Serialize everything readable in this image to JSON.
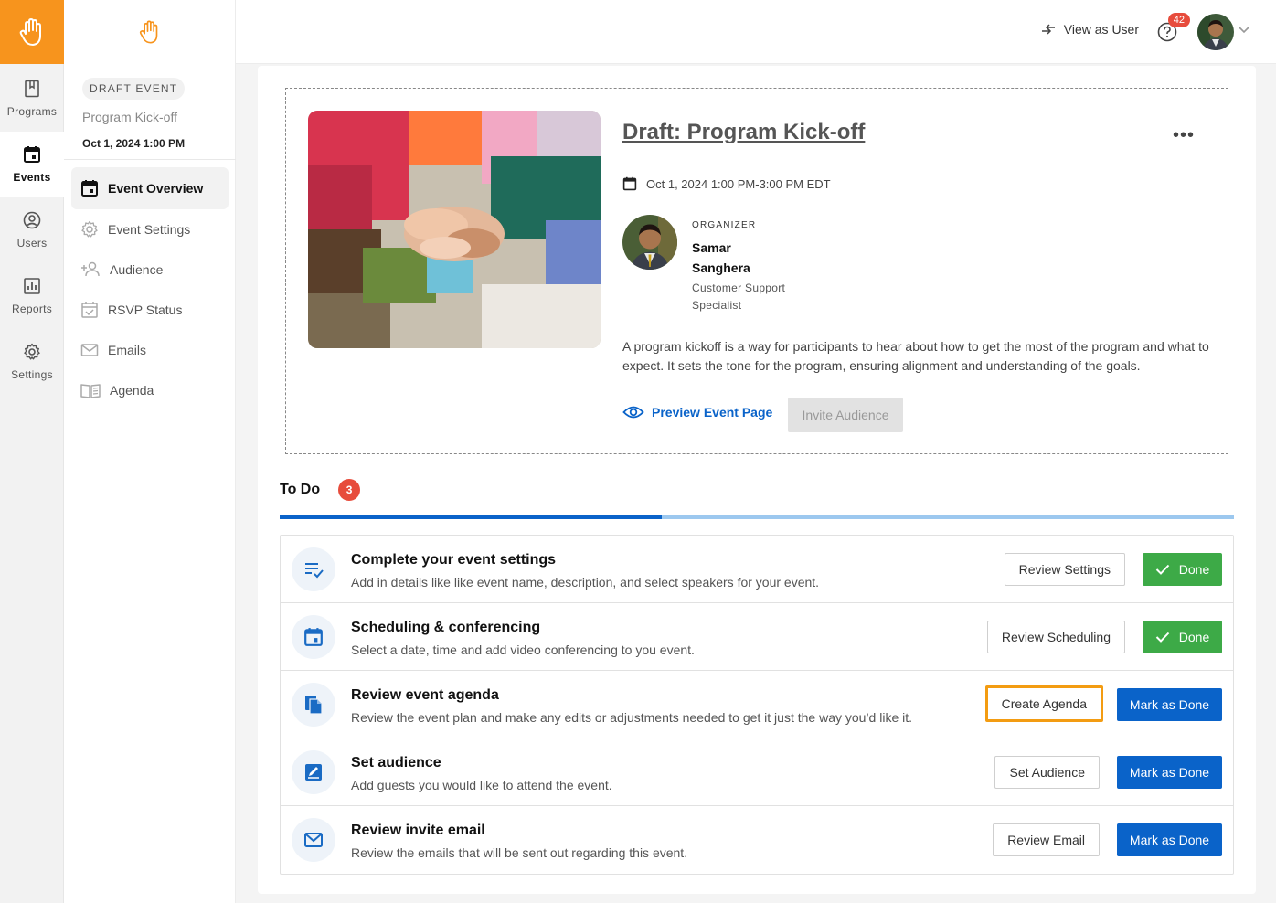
{
  "rail": {
    "items": [
      {
        "label": "Programs",
        "icon": "book-icon"
      },
      {
        "label": "Events",
        "icon": "calendar-icon"
      },
      {
        "label": "Users",
        "icon": "user-circle-icon"
      },
      {
        "label": "Reports",
        "icon": "bar-chart-icon"
      },
      {
        "label": "Settings",
        "icon": "gear-icon"
      }
    ]
  },
  "sidebar": {
    "badge": "DRAFT EVENT",
    "event_name": "Program Kick-off",
    "event_date": "Oct 1, 2024 1:00 PM",
    "items": [
      {
        "label": "Event Overview",
        "icon": "calendar-icon"
      },
      {
        "label": "Event Settings",
        "icon": "gear-icon"
      },
      {
        "label": "Audience",
        "icon": "add-user-icon"
      },
      {
        "label": "RSVP Status",
        "icon": "calendar-check-icon"
      },
      {
        "label": "Emails",
        "icon": "envelope-icon"
      },
      {
        "label": "Agenda",
        "icon": "book-open-icon"
      }
    ]
  },
  "topbar": {
    "view_as_user": "View as User",
    "notification_count": "42"
  },
  "event": {
    "title": "Draft: Program Kick-off",
    "datetime": "Oct 1, 2024 1:00 PM-3:00 PM EDT",
    "organizer_label": "ORGANIZER",
    "organizer_name": "Samar Sanghera",
    "organizer_role": "Customer Support Specialist",
    "description": "A program kickoff is a way for participants to hear about how to get the most of the program and what to expect. It sets the tone for the program, ensuring alignment and understanding of the goals.",
    "preview_label": "Preview Event Page",
    "invite_label": "Invite Audience"
  },
  "todo": {
    "title": "To Do",
    "count": "3",
    "progress": 0.4,
    "tasks": [
      {
        "title": "Complete your event settings",
        "desc": "Add in details like like event name, description, and select speakers for your event.",
        "action": "Review Settings",
        "status": "Done",
        "done": true,
        "icon": "list-check-icon"
      },
      {
        "title": "Scheduling & conferencing",
        "desc": "Select a date, time and add video conferencing to you event.",
        "action": "Review Scheduling",
        "status": "Done",
        "done": true,
        "icon": "calendar-icon"
      },
      {
        "title": "Review event agenda",
        "desc": "Review the event plan and make any edits or adjustments needed to get it just the way you’d like it.",
        "action": "Create Agenda",
        "status": "Mark as Done",
        "done": false,
        "icon": "documents-icon",
        "highlighted": true
      },
      {
        "title": "Set audience",
        "desc": "Add guests you would like to attend the event.",
        "action": "Set Audience",
        "status": "Mark as Done",
        "done": false,
        "icon": "edit-icon"
      },
      {
        "title": "Review invite email",
        "desc": "Review the emails that will be sent out regarding this event.",
        "action": "Review Email",
        "status": "Mark as Done",
        "done": false,
        "icon": "envelope-icon"
      }
    ]
  },
  "colors": {
    "brand_orange": "#f7941d",
    "primary_blue": "#0a63c9",
    "done_green": "#3daa47",
    "badge_red": "#e74c3c",
    "highlight_orange": "#f39c12"
  }
}
